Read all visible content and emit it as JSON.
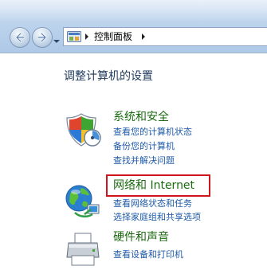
{
  "address_bar": {
    "breadcrumb": "控制面板"
  },
  "main": {
    "title": "调整计算机的设置",
    "categories": [
      {
        "title": "系统和安全",
        "icon": "shield-icon",
        "links": [
          "查看您的计算机状态",
          "备份您的计算机",
          "查找并解决问题"
        ]
      },
      {
        "title": "网络和 Internet",
        "icon": "network-globe-icon",
        "links": [
          "查看网络状态和任务",
          "选择家庭组和共享选项"
        ],
        "highlighted": true
      },
      {
        "title": "硬件和声音",
        "icon": "printer-icon",
        "links": [
          "查看设备和打印机"
        ]
      }
    ]
  },
  "colors": {
    "category_title": "#1b6a0f",
    "link": "#1e5aa8",
    "page_title": "#1e395b",
    "highlight_border": "#d0141b"
  }
}
